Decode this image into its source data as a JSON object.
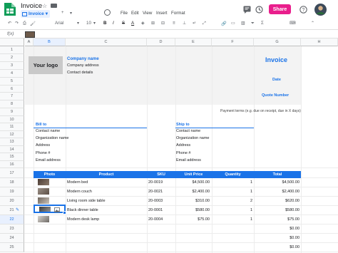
{
  "app": {
    "title": "Invoice",
    "sheet_name": "Invoice",
    "menus": [
      "File",
      "Edit",
      "View",
      "Insert",
      "Format"
    ],
    "share_label": "Share",
    "accent_color": "#1a73e8",
    "share_color": "#e91e8c"
  },
  "toolbar": {
    "font": "Arial",
    "font_size": "10",
    "bold": "B",
    "italic": "I",
    "strikethrough": "S",
    "text_color": "A"
  },
  "formula_bar": {
    "fx_label": "f(x)"
  },
  "grid": {
    "columns": [
      "A",
      "B",
      "C",
      "D",
      "E",
      "F",
      "G",
      "H"
    ],
    "rows": [
      "1",
      "2",
      "3",
      "4",
      "5",
      "6",
      "7",
      "8",
      "9",
      "10",
      "11",
      "12",
      "13",
      "14",
      "15",
      "16",
      "17",
      "18",
      "19",
      "20",
      "21",
      "22",
      "23",
      "24",
      "25"
    ],
    "active_row": "22",
    "active_column": "B"
  },
  "invoice": {
    "logo_text": "Your logo",
    "company_name": "Company name",
    "company_address": "Company address",
    "contact_details": "Contact details",
    "title": "Invoice",
    "date_label": "Date",
    "quote_label": "Quote Number",
    "payment_terms": "Payment terms (e.g. due on receipt, due in X days)",
    "bill_to": {
      "heading": "Bill to",
      "lines": [
        "Contact name",
        "Organization name",
        "Address",
        "Phone #",
        "Email address"
      ]
    },
    "ship_to": {
      "heading": "Ship to",
      "lines": [
        "Contact name",
        "Organization name",
        "Address",
        "Phone #",
        "Email address"
      ]
    },
    "table": {
      "headers": [
        "Photo",
        "Product",
        "SKU",
        "Unit Price",
        "Quantity",
        "Total"
      ],
      "items": [
        {
          "product": "Modern bed",
          "sku": "20-0019",
          "unit_price": "$4,500.00",
          "quantity": "1",
          "total": "$4,500.00"
        },
        {
          "product": "Modern couch",
          "sku": "20-0021",
          "unit_price": "$2,400.00",
          "quantity": "1",
          "total": "$2,400.00"
        },
        {
          "product": "Living room side table",
          "sku": "20-0003",
          "unit_price": "$310.00",
          "quantity": "2",
          "total": "$620.00"
        },
        {
          "product": "Black dinner table",
          "sku": "20-0001",
          "unit_price": "$580.00",
          "quantity": "1",
          "total": "$580.00"
        },
        {
          "product": "Modern desk lamp",
          "sku": "20-0004",
          "unit_price": "$75.00",
          "quantity": "1",
          "total": "$75.00"
        }
      ],
      "empty_totals": [
        "$0.00",
        "$0.00",
        "$0.00"
      ]
    }
  }
}
